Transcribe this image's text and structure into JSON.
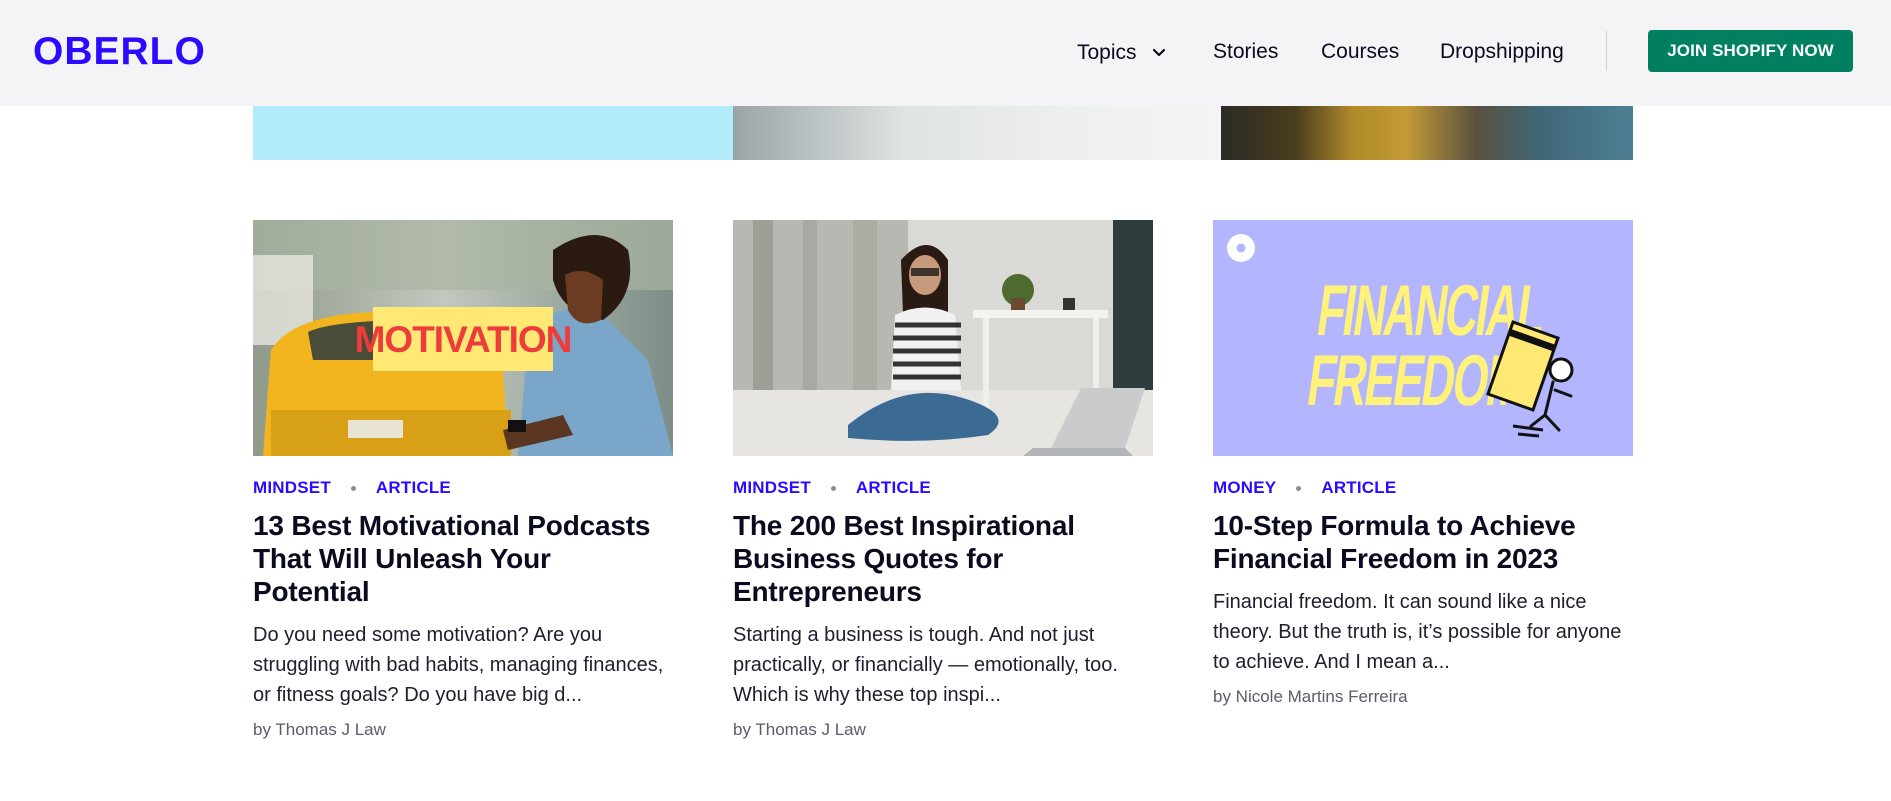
{
  "brand": {
    "logo_text": "OBERLO",
    "logo_color": "#2a0bff",
    "cta_color": "#008060"
  },
  "nav": {
    "items": [
      {
        "label": "Topics",
        "has_dropdown": true
      },
      {
        "label": "Stories"
      },
      {
        "label": "Courses"
      },
      {
        "label": "Dropshipping"
      }
    ],
    "cta_label": "JOIN SHOPIFY NOW"
  },
  "cards": [
    {
      "image_text": "MOTIVATION",
      "category": "MINDSET",
      "type": "ARTICLE",
      "title": "13 Best Motivational Podcasts That Will Unleash Your Potential",
      "excerpt": "Do you need some motivation? Are you struggling with bad habits, managing finances, or fitness goals? Do you have big d...",
      "author": "by Thomas J Law"
    },
    {
      "category": "MINDSET",
      "type": "ARTICLE",
      "title": "The 200 Best Inspirational Business Quotes for Entrepreneurs",
      "excerpt": "Starting a business is tough. And not just practically, or financially — emotionally, too. Which is why these top inspi...",
      "author": "by Thomas J Law"
    },
    {
      "image_text_line1": "FINANCIAL",
      "image_text_line2": "FREEDOM",
      "category": "MONEY",
      "type": "ARTICLE",
      "title": "10-Step Formula to Achieve Financial Freedom in 2023",
      "excerpt": "Financial freedom. It can sound like a nice theory. But the truth is, it’s possible for anyone to achieve. And I mean a...",
      "author": "by Nicole Martins Ferreira"
    }
  ]
}
